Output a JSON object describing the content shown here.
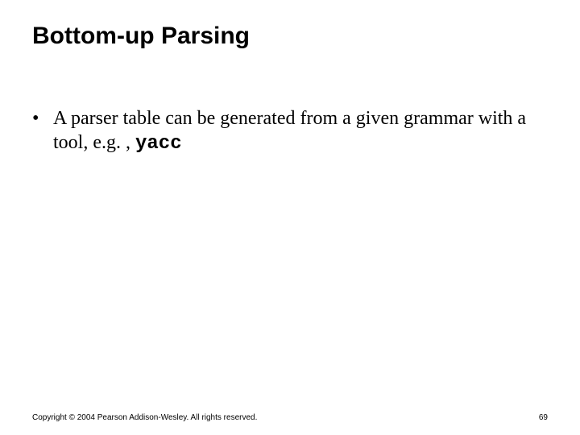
{
  "title": "Bottom-up Parsing",
  "bullets": [
    {
      "dot": "•",
      "text": "A parser table can be generated from a given grammar with a tool, e.g. , ",
      "code": "yacc"
    }
  ],
  "footer": {
    "copyright": "Copyright © 2004 Pearson Addison-Wesley. All rights reserved.",
    "page": "69"
  }
}
